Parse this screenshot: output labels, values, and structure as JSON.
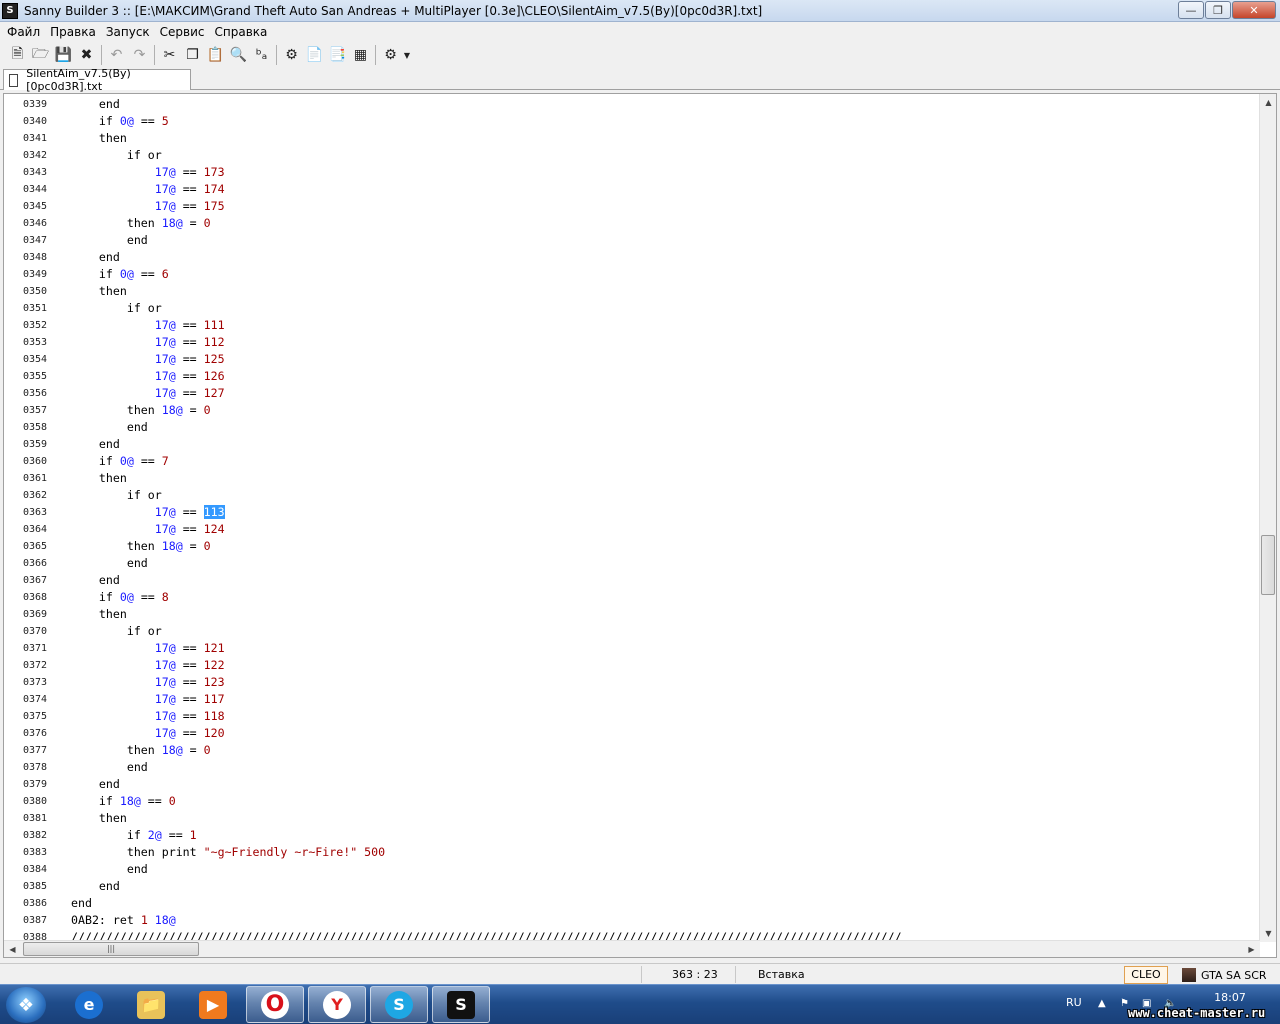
{
  "window": {
    "title": "Sanny Builder 3 :: [E:\\МАКСИМ\\Grand Theft Auto San Andreas + MultiPlayer [0.3e]\\CLEO\\SilentAim_v7.5(By)[0pc0d3R].txt]"
  },
  "menu": [
    "Файл",
    "Правка",
    "Запуск",
    "Сервис",
    "Справка"
  ],
  "tab": {
    "label": "SilentAim_v7.5(By)[0pc0d3R].txt"
  },
  "editor": {
    "lines": [
      {
        "n": "0339",
        "t": "    end"
      },
      {
        "n": "0340",
        "t": "    if 0@ == 5"
      },
      {
        "n": "0341",
        "t": "    then"
      },
      {
        "n": "0342",
        "t": "        if or"
      },
      {
        "n": "0343",
        "t": "            17@ == 173"
      },
      {
        "n": "0344",
        "t": "            17@ == 174"
      },
      {
        "n": "0345",
        "t": "            17@ == 175"
      },
      {
        "n": "0346",
        "t": "        then 18@ = 0"
      },
      {
        "n": "0347",
        "t": "        end"
      },
      {
        "n": "0348",
        "t": "    end"
      },
      {
        "n": "0349",
        "t": "    if 0@ == 6"
      },
      {
        "n": "0350",
        "t": "    then"
      },
      {
        "n": "0351",
        "t": "        if or"
      },
      {
        "n": "0352",
        "t": "            17@ == 111"
      },
      {
        "n": "0353",
        "t": "            17@ == 112"
      },
      {
        "n": "0354",
        "t": "            17@ == 125"
      },
      {
        "n": "0355",
        "t": "            17@ == 126"
      },
      {
        "n": "0356",
        "t": "            17@ == 127"
      },
      {
        "n": "0357",
        "t": "        then 18@ = 0"
      },
      {
        "n": "0358",
        "t": "        end"
      },
      {
        "n": "0359",
        "t": "    end"
      },
      {
        "n": "0360",
        "t": "    if 0@ == 7"
      },
      {
        "n": "0361",
        "t": "    then"
      },
      {
        "n": "0362",
        "t": "        if or"
      },
      {
        "n": "0363",
        "t": "            17@ == 113",
        "selected": "113"
      },
      {
        "n": "0364",
        "t": "            17@ == 124"
      },
      {
        "n": "0365",
        "t": "        then 18@ = 0"
      },
      {
        "n": "0366",
        "t": "        end"
      },
      {
        "n": "0367",
        "t": "    end"
      },
      {
        "n": "0368",
        "t": "    if 0@ == 8"
      },
      {
        "n": "0369",
        "t": "    then"
      },
      {
        "n": "0370",
        "t": "        if or"
      },
      {
        "n": "0371",
        "t": "            17@ == 121"
      },
      {
        "n": "0372",
        "t": "            17@ == 122"
      },
      {
        "n": "0373",
        "t": "            17@ == 123"
      },
      {
        "n": "0374",
        "t": "            17@ == 117"
      },
      {
        "n": "0375",
        "t": "            17@ == 118"
      },
      {
        "n": "0376",
        "t": "            17@ == 120"
      },
      {
        "n": "0377",
        "t": "        then 18@ = 0"
      },
      {
        "n": "0378",
        "t": "        end"
      },
      {
        "n": "0379",
        "t": "    end"
      },
      {
        "n": "0380",
        "t": "    if 18@ == 0"
      },
      {
        "n": "0381",
        "t": "    then"
      },
      {
        "n": "0382",
        "t": "        if 2@ == 1"
      },
      {
        "n": "0383",
        "t": "        then print \"~g~Friendly ~r~Fire!\" 500"
      },
      {
        "n": "0384",
        "t": "        end"
      },
      {
        "n": "0385",
        "t": "    end"
      },
      {
        "n": "0386",
        "t": "end"
      },
      {
        "n": "0387",
        "t": "0AB2: ret 1 18@"
      },
      {
        "n": "0388",
        "t": "///////////////////////////////////////////////////////////////////////////////////////////////////////////////////////"
      }
    ],
    "colors": {
      "variable": "#1a1aff",
      "number": "#a00000",
      "string": "#a00000",
      "selection": "#3399ff"
    }
  },
  "statusbar": {
    "position": "363 : 23",
    "mode": "Вставка",
    "format": "CLEO",
    "game": "GTA SA SCR"
  },
  "taskbar": {
    "apps": [
      "internet-explorer",
      "windows-explorer",
      "media-player",
      "opera",
      "yandex-browser",
      "skype",
      "sanny-builder"
    ],
    "tray": {
      "language": "RU",
      "time": "18:07"
    }
  },
  "watermark": "www.cheat-master.ru"
}
